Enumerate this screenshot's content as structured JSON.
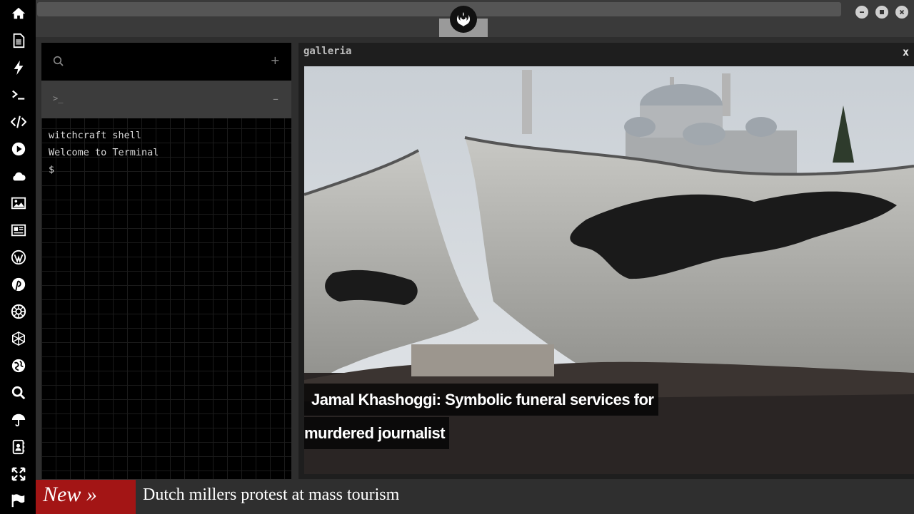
{
  "sidebar": {
    "icons": [
      "home-icon",
      "document-icon",
      "bolt-icon",
      "terminal-icon",
      "code-icon",
      "play-icon",
      "cloud-icon",
      "image-icon",
      "news-icon",
      "wordpress-icon",
      "pinterest-icon",
      "empire-icon",
      "globe-wireframe-icon",
      "world-icon",
      "search-icon",
      "umbrella-icon",
      "contacts-icon",
      "expand-icon",
      "flag-icon"
    ]
  },
  "window_controls": [
    "minimize",
    "maximize",
    "close"
  ],
  "terminal": {
    "plus_label": "+",
    "prompt_label": ">_",
    "minus_label": "–",
    "lines": [
      "witchcraft shell",
      "Welcome to Terminal",
      "$"
    ]
  },
  "galleria": {
    "title": "galleria",
    "close_label": "x",
    "caption_line1": "Jamal Khashoggi: Symbolic funeral services for",
    "caption_line2": "murdered journalist"
  },
  "ticker": {
    "label": "New »",
    "headline": "Dutch millers protest at mass tourism"
  }
}
